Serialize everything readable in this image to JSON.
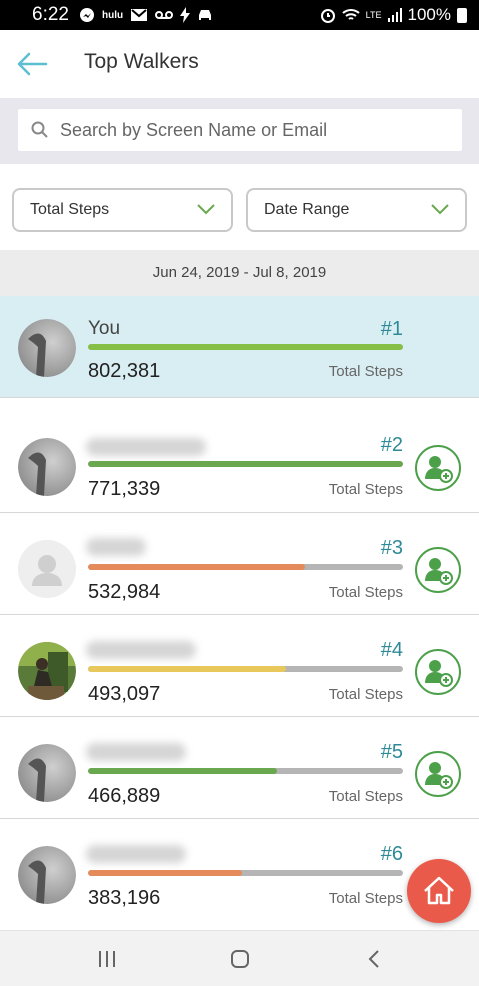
{
  "status": {
    "time": "6:22",
    "left_icons": [
      "messenger-icon",
      "hulu-icon",
      "gmail-icon",
      "voicemail-icon",
      "flash-icon",
      "car-icon"
    ],
    "hulu_text": "hulu",
    "network": "LTE",
    "battery": "100%"
  },
  "app_bar": {
    "title": "Top Walkers"
  },
  "search": {
    "placeholder": "Search by Screen Name or Email"
  },
  "filters": {
    "metric": "Total Steps",
    "date_range": "Date Range"
  },
  "date_range": "Jun 24, 2019 - Jul 8, 2019",
  "colors": {
    "accent": "#2f8a96",
    "green": "#6aa84f",
    "orange": "#e58a5a",
    "yellow": "#e8c85a",
    "fab": "#ea5a4a"
  },
  "leaders": [
    {
      "name": "You",
      "rank": "#1",
      "steps": "802,381",
      "label": "Total Steps",
      "progress": 1.0,
      "bar_color": "#86bf46",
      "avatar": "default-gray-avatar"
    },
    {
      "name": "",
      "rank": "#2",
      "steps": "771,339",
      "label": "Total Steps",
      "progress": 1.0,
      "bar_color": "#6aa84f",
      "avatar": "default-gray-avatar"
    },
    {
      "name": "",
      "rank": "#3",
      "steps": "532,984",
      "label": "Total Steps",
      "progress": 0.69,
      "bar_color": "#e58a5a",
      "avatar": "placeholder-person-avatar"
    },
    {
      "name": "",
      "rank": "#4",
      "steps": "493,097",
      "label": "Total Steps",
      "progress": 0.63,
      "bar_color": "#e8c85a",
      "avatar": "photo-avatar"
    },
    {
      "name": "",
      "rank": "#5",
      "steps": "466,889",
      "label": "Total Steps",
      "progress": 0.6,
      "bar_color": "#6aa84f",
      "avatar": "default-gray-avatar"
    },
    {
      "name": "",
      "rank": "#6",
      "steps": "383,196",
      "label": "Total Steps",
      "progress": 0.49,
      "bar_color": "#e58a5a",
      "avatar": "default-gray-avatar"
    }
  ],
  "nav": [
    "recent-apps-icon",
    "home-icon",
    "back-icon"
  ]
}
